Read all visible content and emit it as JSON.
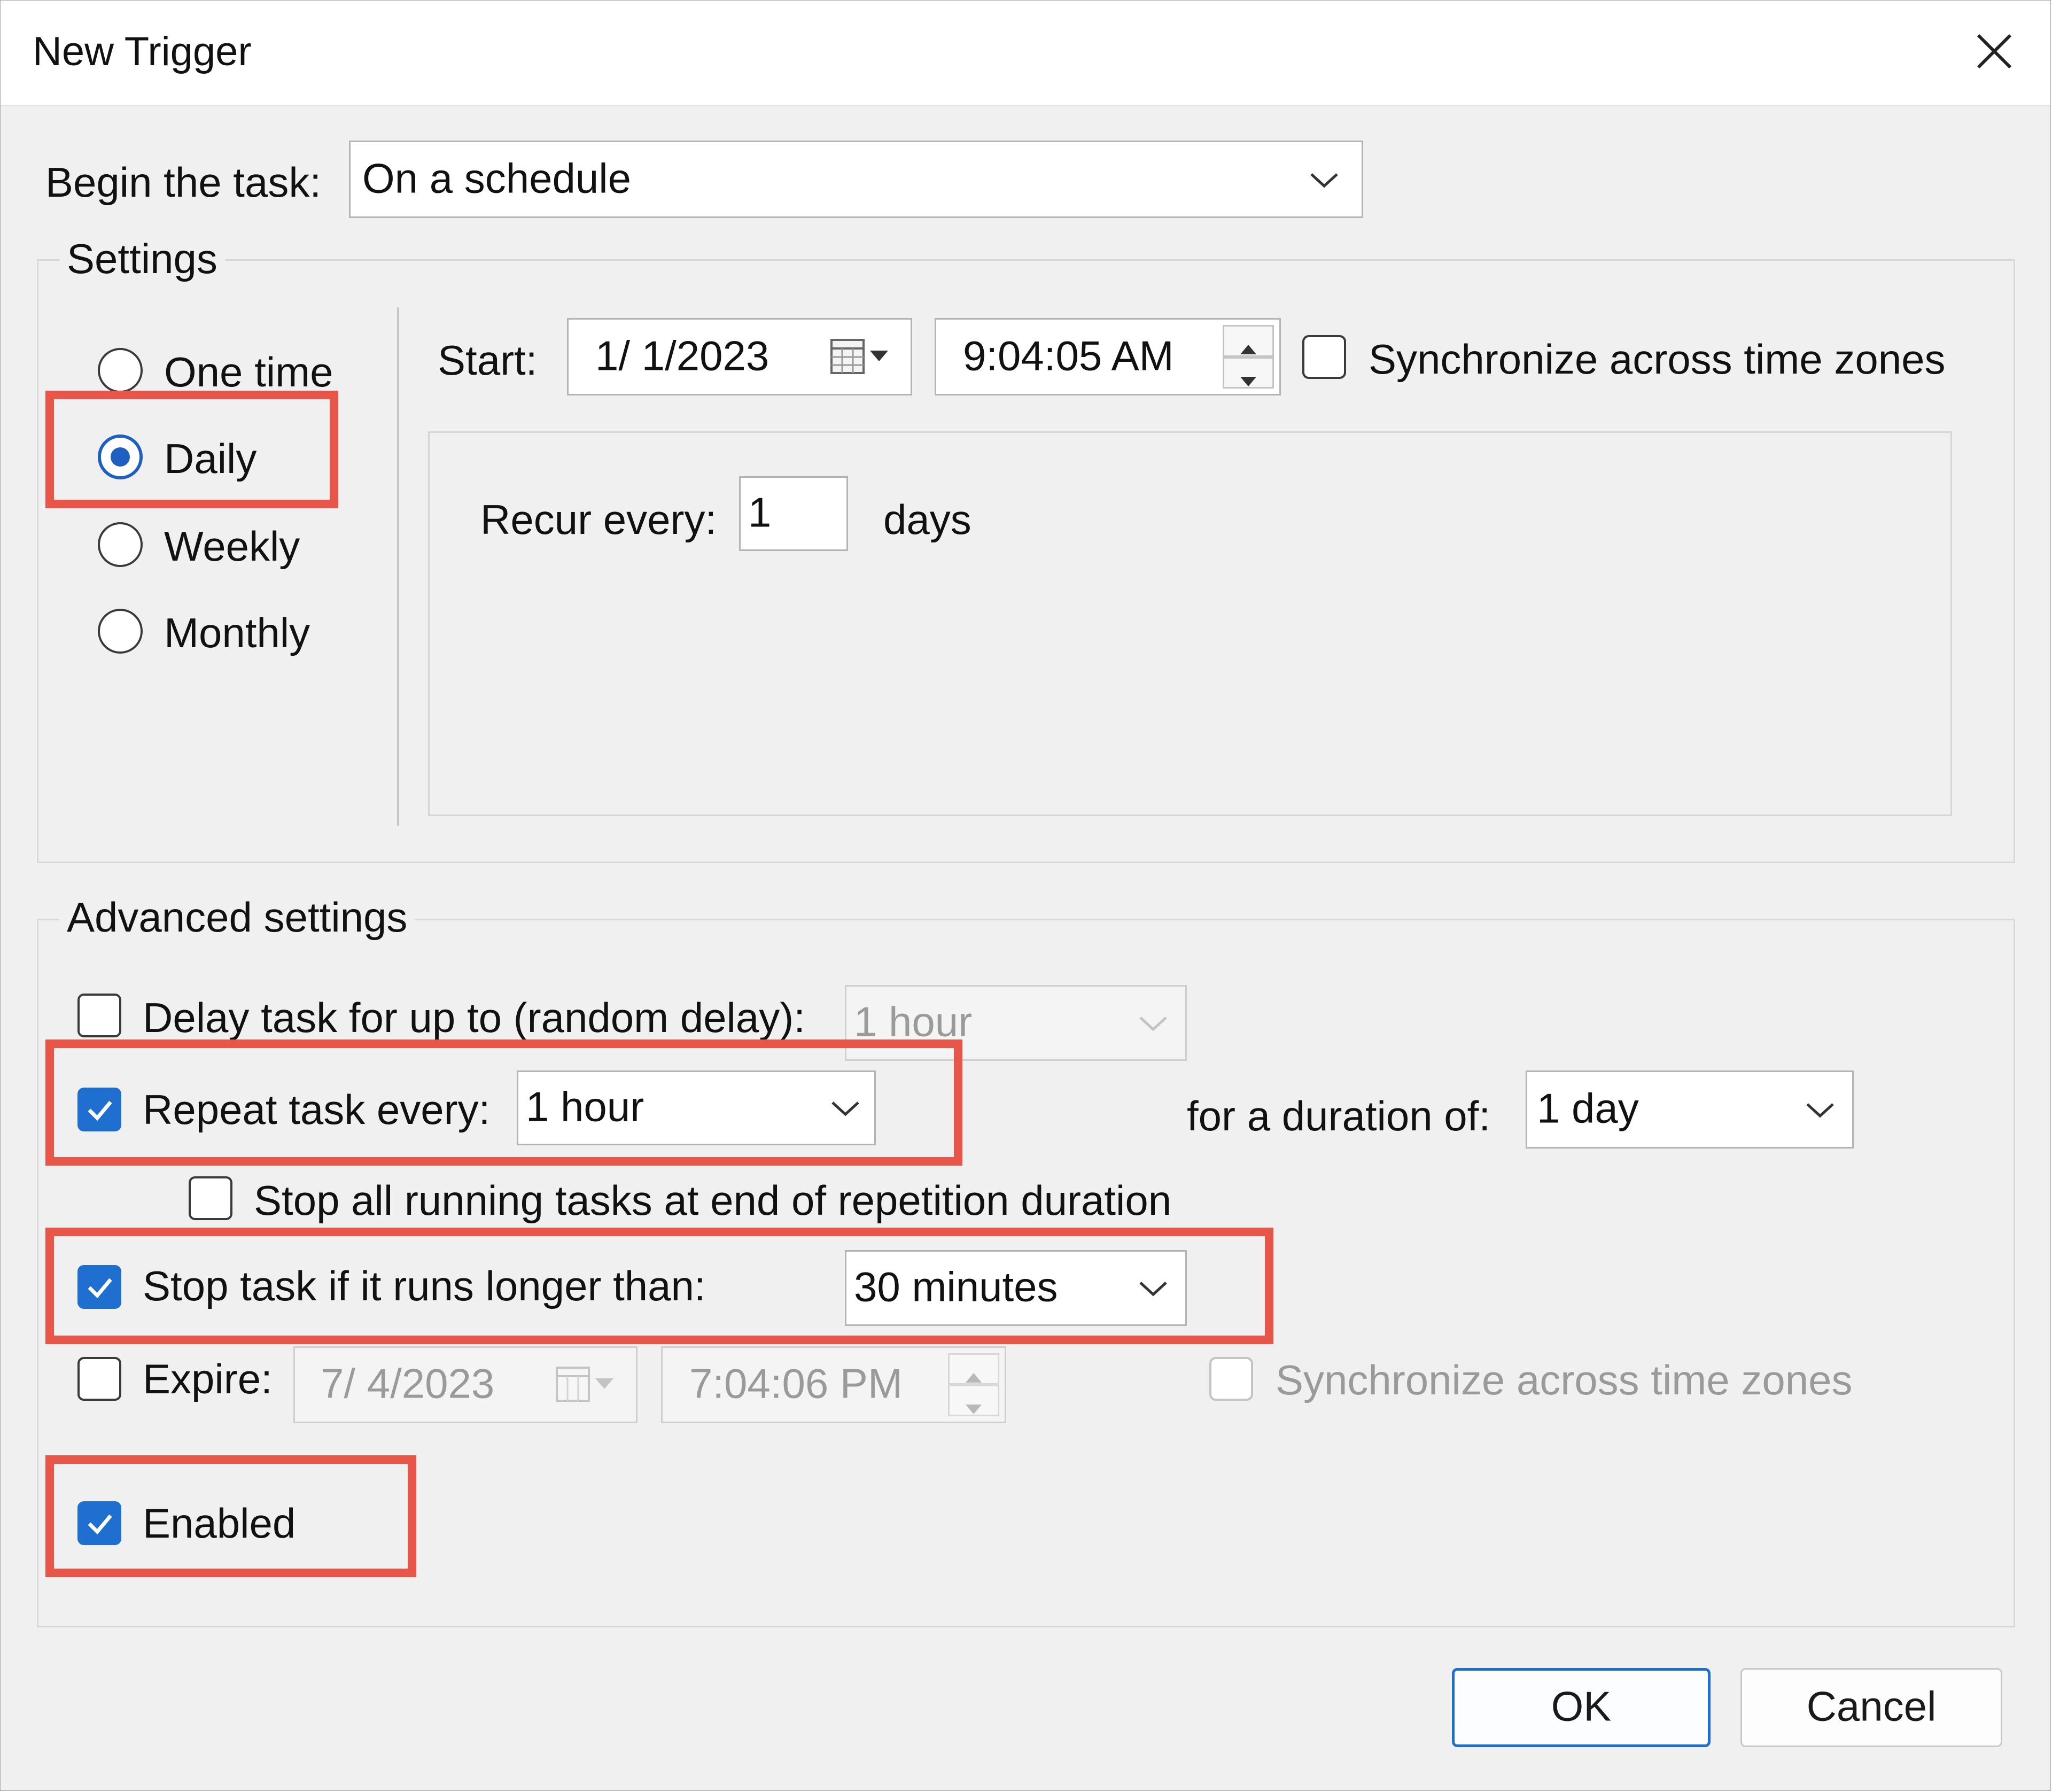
{
  "window": {
    "title": "New Trigger"
  },
  "begin": {
    "label": "Begin the task:",
    "value": "On a schedule"
  },
  "settings": {
    "group_title": "Settings",
    "options": [
      {
        "label": "One time",
        "selected": false
      },
      {
        "label": "Daily",
        "selected": true
      },
      {
        "label": "Weekly",
        "selected": false
      },
      {
        "label": "Monthly",
        "selected": false
      }
    ],
    "start_label": "Start:",
    "start_date": "1/  1/2023",
    "start_time": "9:04:05 AM",
    "sync_label": "Synchronize across time zones",
    "sync_checked": false,
    "recur_label": "Recur every:",
    "recur_value": "1",
    "recur_unit": "days"
  },
  "advanced": {
    "group_title": "Advanced settings",
    "delay": {
      "label": "Delay task for up to (random delay):",
      "value": "1 hour",
      "checked": false,
      "enabled": false
    },
    "repeat": {
      "label": "Repeat task every:",
      "value": "1 hour",
      "checked": true
    },
    "duration": {
      "label": "for a duration of:",
      "value": "1 day"
    },
    "stop_all": {
      "label": "Stop all running tasks at end of repetition duration",
      "checked": false
    },
    "stop_if": {
      "label": "Stop task if it runs longer than:",
      "value": "30 minutes",
      "checked": true
    },
    "expire": {
      "label": "Expire:",
      "date": "7/  4/2023",
      "time": "7:04:06 PM",
      "checked": false,
      "sync_label": "Synchronize across time zones"
    },
    "enabled": {
      "label": "Enabled",
      "checked": true
    }
  },
  "buttons": {
    "ok": "OK",
    "cancel": "Cancel"
  },
  "colors": {
    "accent": "#1f6fd0",
    "highlight": "#e8564a",
    "background": "#f0f0f0"
  }
}
